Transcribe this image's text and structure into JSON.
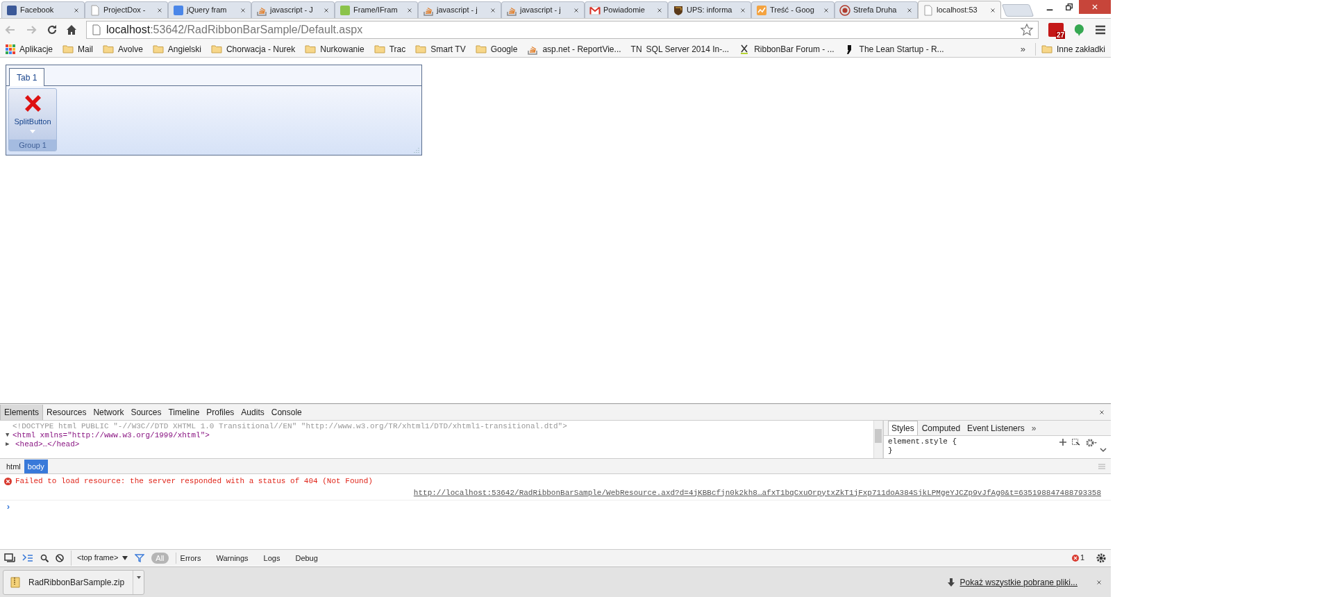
{
  "tabs": [
    {
      "title": "Facebook",
      "kind": "social",
      "selected": false
    },
    {
      "title": "ProjectDox -",
      "kind": "page",
      "selected": false
    },
    {
      "title": "jQuery fram",
      "kind": "search",
      "selected": false
    },
    {
      "title": "javascript - J",
      "kind": "stack",
      "selected": false
    },
    {
      "title": "Frame/IFram",
      "kind": "web",
      "selected": false
    },
    {
      "title": "javascript - j",
      "kind": "stack",
      "selected": false
    },
    {
      "title": "javascript - j",
      "kind": "stack",
      "selected": false
    },
    {
      "title": "Powiadomie",
      "kind": "mail",
      "selected": false
    },
    {
      "title": "UPS: informa",
      "kind": "shield",
      "selected": false
    },
    {
      "title": "Treść - Goog",
      "kind": "chart",
      "selected": false
    },
    {
      "title": "Strefa Druha",
      "kind": "emblem",
      "selected": false
    },
    {
      "title": "localhost:53",
      "kind": "page",
      "selected": true
    }
  ],
  "address": {
    "host": "localhost",
    "path": ":53642/RadRibbonBarSample/Default.aspx"
  },
  "extension_badge": "27",
  "bookmarks": [
    {
      "label": "Aplikacje",
      "kind": "apps"
    },
    {
      "label": "Mail",
      "kind": "folder"
    },
    {
      "label": "Avolve",
      "kind": "folder"
    },
    {
      "label": "Angielski",
      "kind": "folder"
    },
    {
      "label": "Chorwacja - Nurek",
      "kind": "folder"
    },
    {
      "label": "Nurkowanie",
      "kind": "folder"
    },
    {
      "label": "Trac",
      "kind": "folder"
    },
    {
      "label": "Smart TV",
      "kind": "folder"
    },
    {
      "label": "Google",
      "kind": "folder"
    },
    {
      "label": "asp.net - ReportVie...",
      "kind": "stack"
    },
    {
      "label": "SQL Server 2014 In-...",
      "kind": "text",
      "badge": "TN"
    },
    {
      "label": "RibbonBar Forum - ...",
      "kind": "ribbon"
    },
    {
      "label": "The Lean Startup - R...",
      "kind": "quote"
    }
  ],
  "bookmarks_overflow": "»",
  "other_bookmarks": "Inne zakładki",
  "ribbon": {
    "tabs": [
      {
        "label": "Tab 1",
        "selected": true
      }
    ],
    "button": "SplitButton",
    "group": "Group 1"
  },
  "devtools": {
    "panels": [
      {
        "label": "Elements",
        "selected": true
      },
      {
        "label": "Resources",
        "selected": false
      },
      {
        "label": "Network",
        "selected": false
      },
      {
        "label": "Sources",
        "selected": false
      },
      {
        "label": "Timeline",
        "selected": false
      },
      {
        "label": "Profiles",
        "selected": false
      },
      {
        "label": "Audits",
        "selected": false
      },
      {
        "label": "Console",
        "selected": false
      }
    ],
    "dom_lines": [
      {
        "text": "<!DOCTYPE html PUBLIC \"-//W3C//DTD XHTML 1.0 Transitional//EN\" \"http://www.w3.org/TR/xhtml1/DTD/xhtml1-transitional.dtd\">",
        "kind": "doctype"
      },
      {
        "text": "<html xmlns=\"http://www.w3.org/1999/xhtml\">",
        "kind": "open",
        "toggle": "▼"
      },
      {
        "text": "<head>…</head>",
        "kind": "collapsed",
        "toggle": "▶"
      }
    ],
    "side_tabs": [
      {
        "label": "Styles",
        "selected": true
      },
      {
        "label": "Computed",
        "selected": false
      },
      {
        "label": "Event Listeners",
        "selected": false
      }
    ],
    "side_more": "»",
    "style_lines": [
      "element.style {",
      "}"
    ],
    "breadcrumbs": [
      {
        "label": "html",
        "selected": false
      },
      {
        "label": "body",
        "selected": true
      }
    ],
    "error": "Failed to load resource: the server responded with a status of 404 (Not Found)",
    "error_link": "http://localhost:53642/RadRibbonBarSample/WebResource.axd?d=4jKBBcfjn0k2kh8…afxT1bqCxuOrpytxZkT1jFxp711doA384SjkLPMgeYJCZp9vJfAg0&t=635198847488793358",
    "prompt": "›",
    "frame": "<top frame>",
    "levels": [
      {
        "label": "All",
        "selected": true
      },
      {
        "label": "Errors",
        "selected": false
      },
      {
        "label": "Warnings",
        "selected": false
      },
      {
        "label": "Logs",
        "selected": false
      },
      {
        "label": "Debug",
        "selected": false
      }
    ],
    "error_count": "1"
  },
  "download": {
    "file": "RadRibbonBarSample.zip",
    "show_all": "Pokaż wszystkie pobrane pliki..."
  }
}
